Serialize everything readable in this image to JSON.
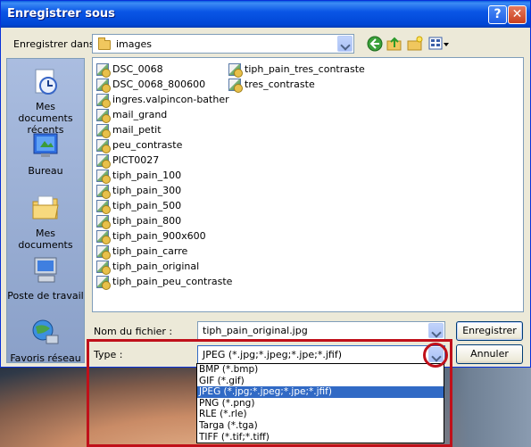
{
  "window": {
    "title": "Enregistrer sous",
    "help_glyph": "?",
    "close_glyph": "✕"
  },
  "lookin": {
    "label": "Enregistrer dans :",
    "value": "images"
  },
  "places": [
    {
      "label": "Mes documents récents",
      "icon": "recent-documents-icon"
    },
    {
      "label": "Bureau",
      "icon": "desktop-icon"
    },
    {
      "label": "Mes documents",
      "icon": "my-documents-icon"
    },
    {
      "label": "Poste de travail",
      "icon": "my-computer-icon"
    },
    {
      "label": "Favoris réseau",
      "icon": "network-places-icon"
    }
  ],
  "files": {
    "column1": [
      "DSC_0068",
      "DSC_0068_800600",
      "ingres.valpincon-bather",
      "mail_grand",
      "mail_petit",
      "peu_contraste",
      "PICT0027",
      "tiph_pain_100",
      "tiph_pain_300",
      "tiph_pain_500",
      "tiph_pain_800",
      "tiph_pain_900x600",
      "tiph_pain_carre",
      "tiph_pain_original",
      "tiph_pain_peu_contraste"
    ],
    "column2": [
      "tiph_pain_tres_contraste",
      "tres_contraste"
    ]
  },
  "filename": {
    "label": "Nom du fichier :",
    "value": "tiph_pain_original.jpg"
  },
  "type": {
    "label": "Type :",
    "value": "JPEG (*.jpg;*.jpeg;*.jpe;*.jfif)",
    "options": [
      "BMP (*.bmp)",
      "GIF (*.gif)",
      "JPEG (*.jpg;*.jpeg;*.jpe;*.jfif)",
      "PNG (*.png)",
      "RLE (*.rle)",
      "Targa (*.tga)",
      "TIFF (*.tif;*.tiff)"
    ],
    "selected_index": 2
  },
  "buttons": {
    "save": "Enregistrer",
    "cancel": "Annuler"
  },
  "colors": {
    "title_bar": "#0054e3",
    "highlight": "#c0101a",
    "selection": "#316ac5"
  }
}
